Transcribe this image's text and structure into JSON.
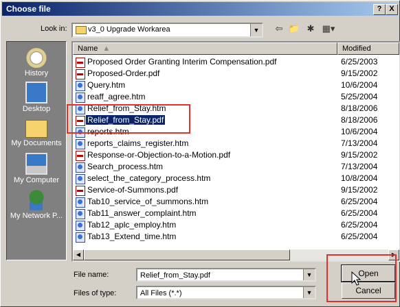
{
  "window": {
    "title": "Choose file"
  },
  "titlebar_buttons": {
    "help": "?",
    "close": "X"
  },
  "lookin": {
    "label": "Look in:",
    "value": "v3_0 Upgrade Workarea"
  },
  "places": [
    {
      "label": "History",
      "icon": "history-icon"
    },
    {
      "label": "Desktop",
      "icon": "desktop-icon"
    },
    {
      "label": "My Documents",
      "icon": "my-documents-icon"
    },
    {
      "label": "My Computer",
      "icon": "my-computer-icon"
    },
    {
      "label": "My Network P...",
      "icon": "my-network-places-icon"
    }
  ],
  "columns": {
    "name": "Name",
    "modified": "Modified"
  },
  "files": [
    {
      "name": "Proposed Order Granting Interim Compensation.pdf",
      "modified": "6/25/2003",
      "type": "pdf"
    },
    {
      "name": "Proposed-Order.pdf",
      "modified": "9/15/2002",
      "type": "pdf"
    },
    {
      "name": "Query.htm",
      "modified": "10/6/2004",
      "type": "htm"
    },
    {
      "name": "reaff_agree.htm",
      "modified": "5/25/2004",
      "type": "htm"
    },
    {
      "name": "Relief_from_Stay.htm",
      "modified": "8/18/2006",
      "type": "htm"
    },
    {
      "name": "Relief_from_Stay.pdf",
      "modified": "8/18/2006",
      "type": "pdf",
      "selected": true
    },
    {
      "name": "reports.htm",
      "modified": "10/6/2004",
      "type": "htm"
    },
    {
      "name": "reports_claims_register.htm",
      "modified": "7/13/2004",
      "type": "htm"
    },
    {
      "name": "Response-or-Objection-to-a-Motion.pdf",
      "modified": "9/15/2002",
      "type": "pdf"
    },
    {
      "name": "Search_process.htm",
      "modified": "7/13/2004",
      "type": "htm"
    },
    {
      "name": "select_the_category_process.htm",
      "modified": "10/8/2004",
      "type": "htm"
    },
    {
      "name": "Service-of-Summons.pdf",
      "modified": "9/15/2002",
      "type": "pdf"
    },
    {
      "name": "Tab10_service_of_summons.htm",
      "modified": "6/25/2004",
      "type": "htm"
    },
    {
      "name": "Tab11_answer_complaint.htm",
      "modified": "6/25/2004",
      "type": "htm"
    },
    {
      "name": "Tab12_aplc_employ.htm",
      "modified": "6/25/2004",
      "type": "htm"
    },
    {
      "name": "Tab13_Extend_time.htm",
      "modified": "6/25/2004",
      "type": "htm"
    }
  ],
  "filename": {
    "label": "File name:",
    "value": "Relief_from_Stay.pdf"
  },
  "filetype": {
    "label": "Files of type:",
    "value": "All Files (*.*)"
  },
  "buttons": {
    "open": "Open",
    "cancel": "Cancel"
  },
  "colors": {
    "titlebar": "#0a246a",
    "selection": "#0a246a",
    "highlight_box": "#e03030"
  }
}
